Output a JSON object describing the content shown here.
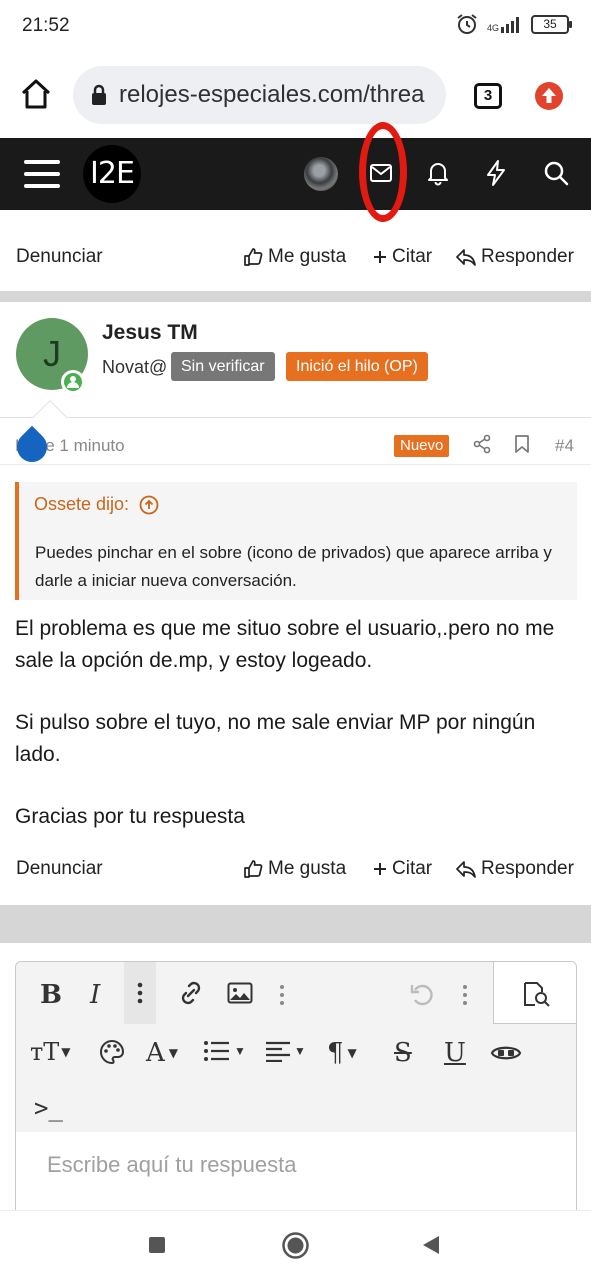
{
  "status_bar": {
    "time": "21:52",
    "network": "4G",
    "battery": "35"
  },
  "browser": {
    "url": "relojes-especiales.com/threa",
    "tab_count": "3"
  },
  "site": {
    "logo_text": "I2E"
  },
  "previous_post": {
    "actions": {
      "report": "Denunciar",
      "like": "Me gusta",
      "quote": "Citar",
      "reply": "Responder"
    }
  },
  "post": {
    "author": {
      "avatar_letter": "J",
      "name": "Jesus TM",
      "title": "Novat@",
      "badge_unverified": "Sin verificar",
      "badge_op": "Inició el hilo (OP)"
    },
    "time": "Hace 1 minuto",
    "new_badge": "Nuevo",
    "number": "#4",
    "quote": {
      "author": "Ossete dijo:",
      "text": "Puedes pinchar en el sobre (icono de privados) que aparece arriba y darle a iniciar nueva conversación."
    },
    "paragraphs": [
      "El problema es que me situo sobre el usuario,.pero no me sale la opción de.mp, y estoy logeado.",
      "Si pulso sobre el tuyo, no me sale enviar MP por ningún lado.",
      "Gracias por tu respuesta"
    ],
    "actions": {
      "report": "Denunciar",
      "like": "Me gusta",
      "quote": "Citar",
      "reply": "Responder"
    }
  },
  "editor": {
    "placeholder": "Escribe aquí tu respuesta",
    "code_icon_text": ">_"
  },
  "colors": {
    "accent": "#e66f20",
    "header_bg": "#1a1a1a",
    "highlight": "#e21b12",
    "avatar_bg": "#5f9a62"
  }
}
